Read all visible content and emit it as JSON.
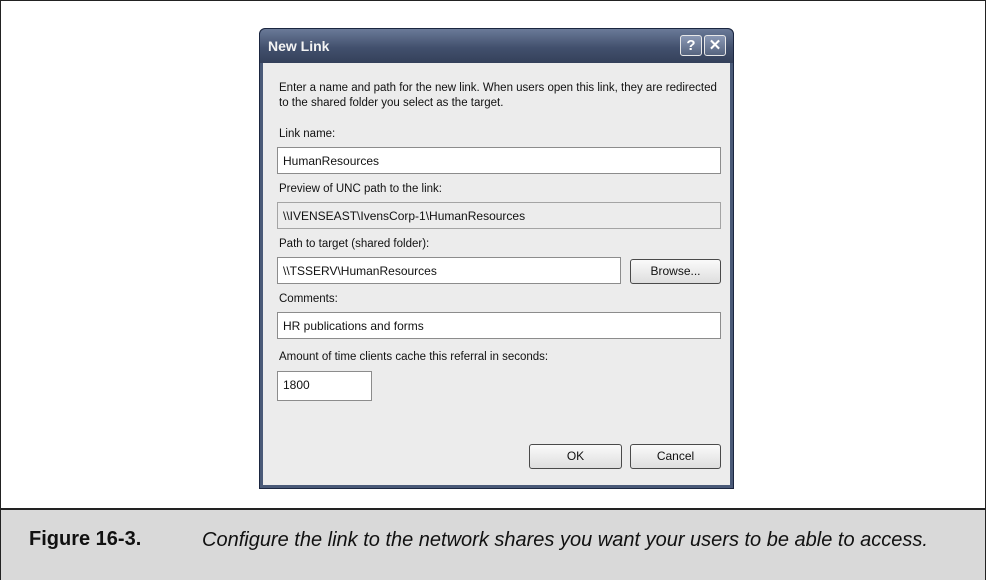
{
  "dialog": {
    "title": "New Link",
    "help_glyph": "?",
    "close_glyph": "✕",
    "description": "Enter a name and path for the new link. When users open this link, they are redirected to the shared folder you select as the target.",
    "link_name_label": "Link name:",
    "link_name_value": "HumanResources",
    "preview_label": "Preview of UNC path to the link:",
    "preview_value": "\\\\IVENSEAST\\IvensCorp-1\\HumanResources",
    "target_label": "Path to target (shared folder):",
    "target_value": "\\\\TSSERV\\HumanResources",
    "browse_label": "Browse...",
    "comments_label": "Comments:",
    "comments_value": "HR publications and forms",
    "cache_label": "Amount of time clients cache this referral in seconds:",
    "cache_value": "1800",
    "ok_label": "OK",
    "cancel_label": "Cancel"
  },
  "caption": {
    "label": "Figure 16-3.",
    "text": "Configure the link to the network shares you want your users to be able to access."
  }
}
